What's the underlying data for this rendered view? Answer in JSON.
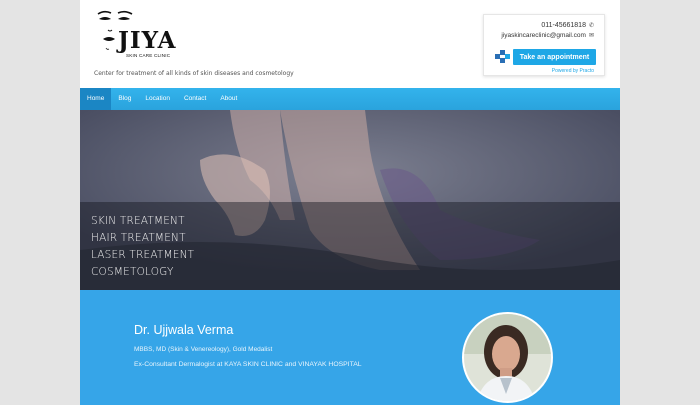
{
  "header": {
    "brand": "JIYA",
    "brand_sub": "SKIN CARE CLINIC",
    "tagline": "Center for treatment of all kinds of skin diseases and cosmetology"
  },
  "contact": {
    "phone": "011-45661818",
    "email": "jiyaskincareclinic@gmail.com",
    "appointment_label": "Take an appointment",
    "powered_by": "Powered by Practo"
  },
  "nav": {
    "items": [
      {
        "label": "Home"
      },
      {
        "label": "Blog"
      },
      {
        "label": "Location"
      },
      {
        "label": "Contact"
      },
      {
        "label": "About"
      }
    ],
    "active": "Home"
  },
  "hero": {
    "items": [
      "SKIN TREATMENT",
      "HAIR TREATMENT",
      "LASER TREATMENT",
      "COSMETOLOGY"
    ]
  },
  "doctor": {
    "name": "Dr. Ujjwala Verma",
    "qualification": "MBBS, MD (Skin & Venereology), Gold Medalist",
    "experience": "Ex-Consultant Dermalogist at KAYA SKIN CLINIC and VINAYAK HOSPITAL"
  },
  "colors": {
    "nav": "#2aa3dd",
    "nav_active": "#1b86c4",
    "doctor_bg": "#36a5e8",
    "button": "#1ea7e6"
  }
}
